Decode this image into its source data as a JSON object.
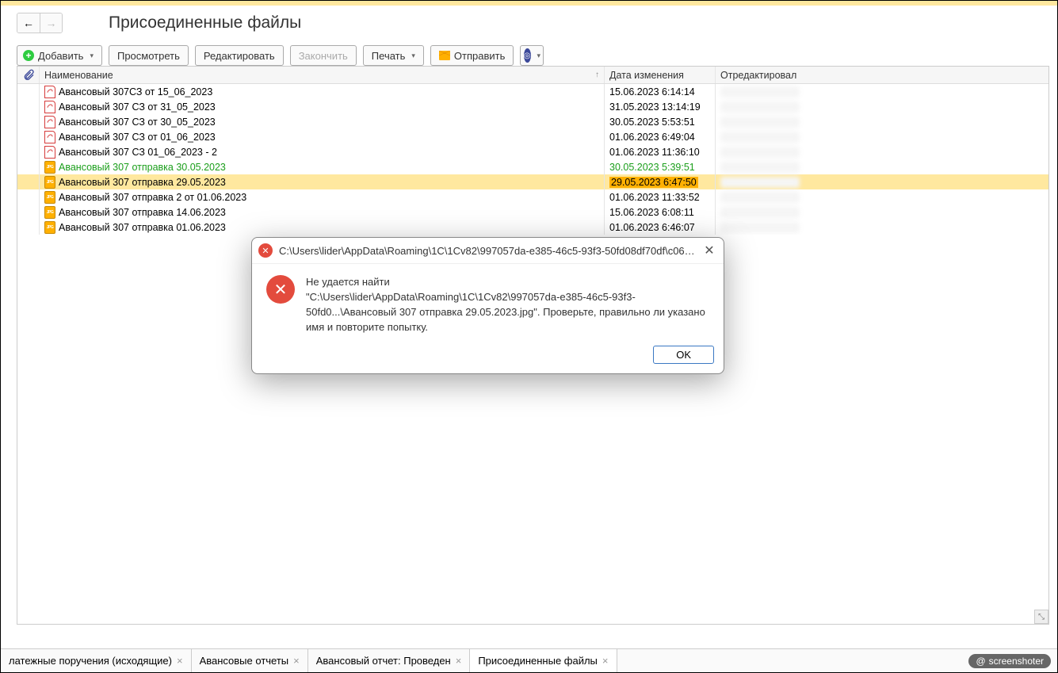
{
  "page_title": "Присоединенные файлы",
  "toolbar": {
    "add": "Добавить",
    "view": "Просмотреть",
    "edit": "Редактировать",
    "finish": "Закончить",
    "print": "Печать",
    "send": "Отправить"
  },
  "columns": {
    "name": "Наименование",
    "date": "Дата изменения",
    "editor": "Отредактировал"
  },
  "rows": [
    {
      "icon": "pdf",
      "name": "Авансовый 307СЗ от 15_06_2023",
      "date": "15.06.2023 6:14:14",
      "editor": "",
      "sel": false,
      "green": false
    },
    {
      "icon": "pdf",
      "name": "Авансовый 307 СЗ от 31_05_2023",
      "date": "31.05.2023 13:14:19",
      "editor": "",
      "sel": false,
      "green": false
    },
    {
      "icon": "pdf",
      "name": "Авансовый 307 СЗ от 30_05_2023",
      "date": "30.05.2023 5:53:51",
      "editor": "",
      "sel": false,
      "green": false
    },
    {
      "icon": "pdf",
      "name": "Авансовый 307 СЗ от 01_06_2023",
      "date": "01.06.2023 6:49:04",
      "editor": "",
      "sel": false,
      "green": false
    },
    {
      "icon": "pdf",
      "name": "Авансовый 307 СЗ 01_06_2023 - 2",
      "date": "01.06.2023 11:36:10",
      "editor": "",
      "sel": false,
      "green": false
    },
    {
      "icon": "jpg",
      "name": "Авансовый 307 отправка 30.05.2023",
      "date": "30.05.2023 5:39:51",
      "editor": "",
      "sel": false,
      "green": true
    },
    {
      "icon": "jpg",
      "name": "Авансовый 307 отправка 29.05.2023",
      "date": "29.05.2023 6:47:50",
      "editor": "",
      "sel": true,
      "green": false
    },
    {
      "icon": "jpg",
      "name": "Авансовый 307 отправка 2 от 01.06.2023",
      "date": "01.06.2023 11:33:52",
      "editor": "",
      "sel": false,
      "green": false
    },
    {
      "icon": "jpg",
      "name": "Авансовый 307 отправка 14.06.2023",
      "date": "15.06.2023 6:08:11",
      "editor": "",
      "sel": false,
      "green": false
    },
    {
      "icon": "jpg",
      "name": "Авансовый 307 отправка 01.06.2023",
      "date": "01.06.2023 6:46:07",
      "editor": "",
      "sel": false,
      "green": false
    }
  ],
  "dialog": {
    "title": "C:\\Users\\lider\\AppData\\Roaming\\1C\\1Cv82\\997057da-e385-46c5-93f3-50fd08df70df\\c067d...",
    "msg_l1": "Не удается найти",
    "msg_l2": "\"C:\\Users\\lider\\AppData\\Roaming\\1C\\1Cv82\\997057da-e385-46c5-93f3-50fd0...\\Авансовый 307 отправка 29.05.2023.jpg\". Проверьте, правильно ли указано имя и повторите попытку.",
    "ok": "OK"
  },
  "tabs": [
    {
      "label": "латежные поручения (исходящие)",
      "active": false
    },
    {
      "label": "Авансовые отчеты",
      "active": false
    },
    {
      "label": "Авансовый отчет: Проведен",
      "active": false
    },
    {
      "label": "Присоединенные файлы",
      "active": true
    }
  ],
  "watermark": "screenshoter"
}
